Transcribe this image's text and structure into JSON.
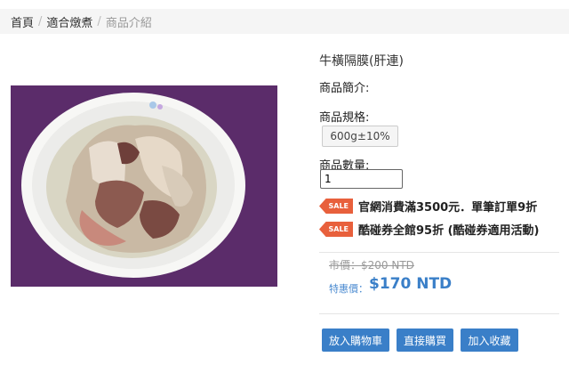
{
  "breadcrumb": {
    "items": [
      "首頁",
      "適合燉煮",
      "商品介紹"
    ],
    "separator": "/"
  },
  "product": {
    "title": "牛橫隔膜(肝連)",
    "intro_label": "商品簡介:",
    "spec_label": "商品規格:",
    "spec_option": "600g±10%",
    "qty_label": "商品數量:",
    "qty_value": "1",
    "image_icon": "soup-bowl-photo"
  },
  "promos": [
    {
      "tag": "SALE",
      "text": "官網消費滿3500元．單筆訂單9折"
    },
    {
      "tag": "SALE",
      "text": "酷碰券全館95折 (酷碰券適用活動)"
    }
  ],
  "price": {
    "market": "市價：$200 NTD",
    "special_label": "特惠價：",
    "special_value": "$170 NTD"
  },
  "buttons": {
    "cart": "放入購物車",
    "buy": "直接購買",
    "favorite": "加入收藏"
  },
  "colors": {
    "accent": "#3a7fc8",
    "sale": "#e8603c",
    "photo_bg": "#5b2c6a"
  }
}
